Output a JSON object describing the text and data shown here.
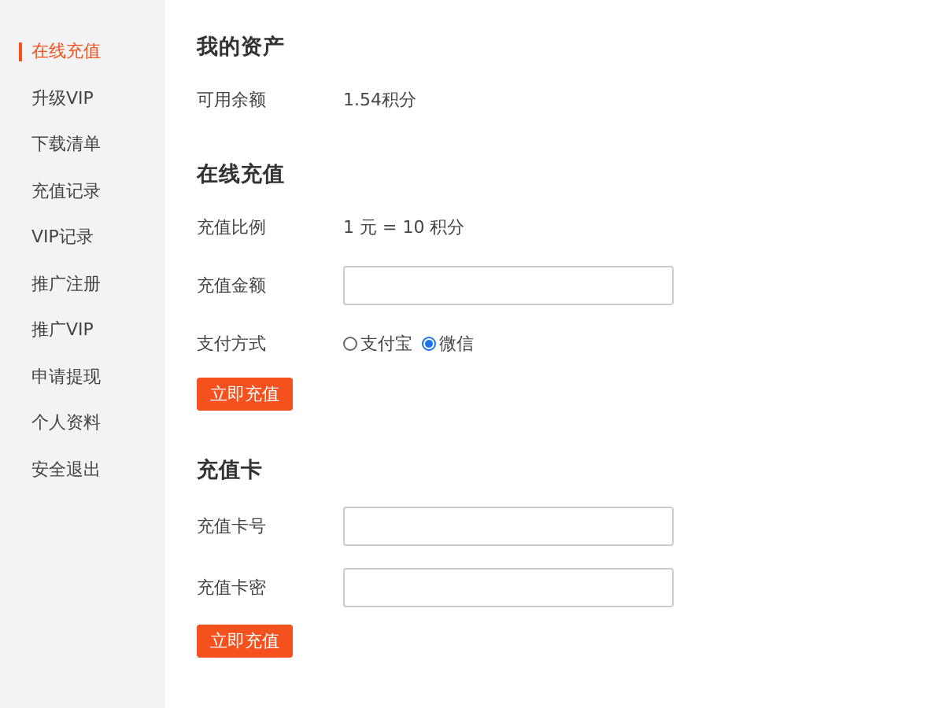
{
  "sidebar": {
    "items": [
      {
        "label": "在线充值",
        "selected": true
      },
      {
        "label": "升级VIP",
        "selected": false
      },
      {
        "label": "下载清单",
        "selected": false
      },
      {
        "label": "充值记录",
        "selected": false
      },
      {
        "label": "VIP记录",
        "selected": false
      },
      {
        "label": "推广注册",
        "selected": false
      },
      {
        "label": "推广VIP",
        "selected": false
      },
      {
        "label": "申请提现",
        "selected": false
      },
      {
        "label": "个人资料",
        "selected": false
      },
      {
        "label": "安全退出",
        "selected": false
      }
    ]
  },
  "sections": [
    {
      "title": "我的资产",
      "rows": [
        {
          "kind": "text",
          "label": "可用余额",
          "value": "1.54积分"
        }
      ]
    },
    {
      "title": "在线充值",
      "rows": [
        {
          "kind": "text",
          "label": "充值比例",
          "value": "1 元 = 10 积分"
        },
        {
          "kind": "input",
          "label": "充值金额"
        },
        {
          "kind": "radio",
          "label": "支付方式",
          "options": [
            {
              "label": "支付宝",
              "selected": false
            },
            {
              "label": "微信",
              "selected": true
            }
          ]
        },
        {
          "kind": "button",
          "label": "立即充值"
        }
      ]
    },
    {
      "title": "充值卡",
      "rows": [
        {
          "kind": "input",
          "label": "充值卡号"
        },
        {
          "kind": "input",
          "label": "充值卡密"
        },
        {
          "kind": "button",
          "label": "立即充值"
        }
      ]
    }
  ]
}
